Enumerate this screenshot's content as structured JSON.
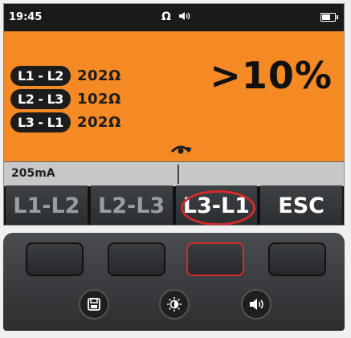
{
  "status_bar": {
    "time": "19:45",
    "icons": "Ω 🔈"
  },
  "readings": [
    {
      "pair": "L1 - L2",
      "value": "202Ω"
    },
    {
      "pair": "L2 - L3",
      "value": "102Ω"
    },
    {
      "pair": "L3 - L1",
      "value": "202Ω"
    }
  ],
  "big_reading": ">10%",
  "current": "205mA",
  "softkeys": [
    {
      "label": "L1-L2",
      "state": "inactive"
    },
    {
      "label": "L2-L3",
      "state": "inactive"
    },
    {
      "label": "L3-L1",
      "state": "active"
    },
    {
      "label": "ESC",
      "state": "normal"
    }
  ],
  "colors": {
    "result_panel": "#f58a25",
    "highlight": "#d42a2a"
  },
  "keypad": {
    "function_keys": 4,
    "highlighted_function_key": 3,
    "round_keys": [
      "save-icon",
      "brightness-icon",
      "speaker-icon"
    ]
  }
}
